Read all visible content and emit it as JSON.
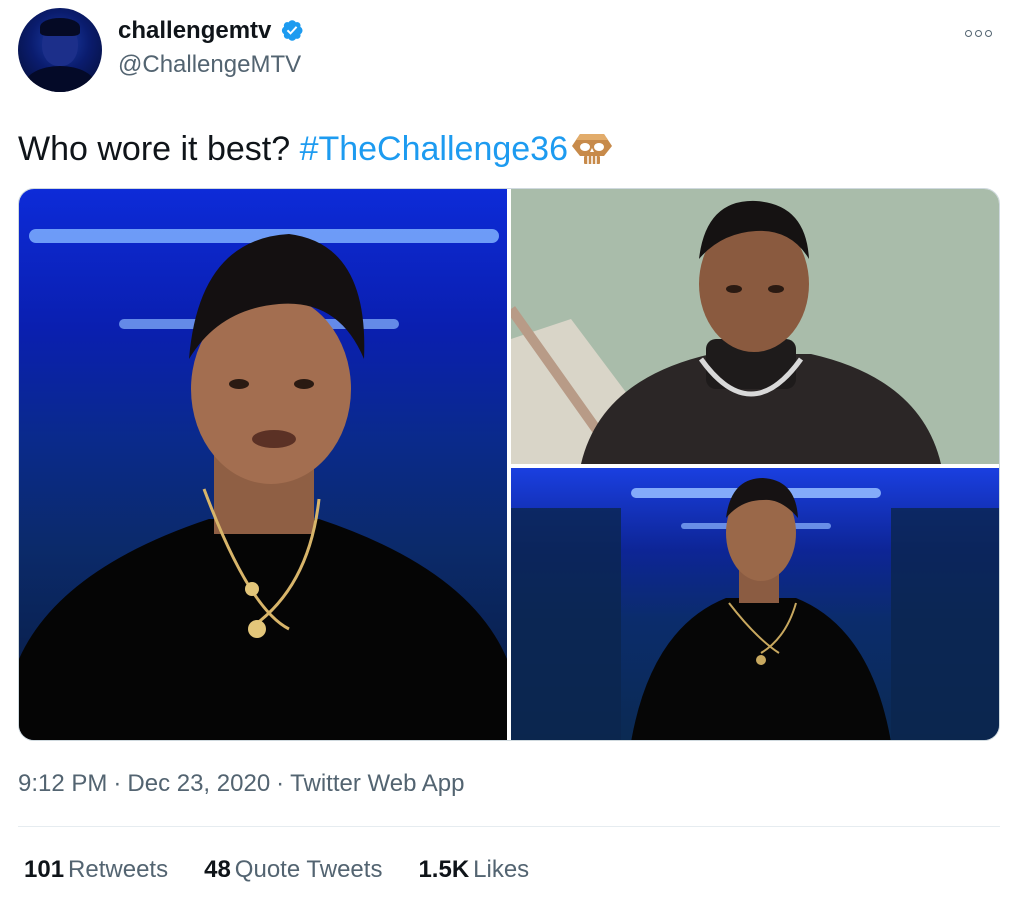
{
  "author": {
    "display_name": "challengemtv",
    "handle": "@ChallengeMTV",
    "verified": true,
    "verified_color": "#1d9bf0"
  },
  "tweet": {
    "text": "Who wore it best? ",
    "hashtag": "#TheChallenge36",
    "hashtag_emoji": "skull-hashflag-icon"
  },
  "media": [
    {
      "description": "man-in-black-turtleneck-blue-room"
    },
    {
      "description": "man-in-black-turtleneck-green-wall"
    },
    {
      "description": "man-in-black-turtleneck-blue-hallway"
    }
  ],
  "meta": {
    "time": "9:12 PM",
    "separator": "·",
    "date": "Dec 23, 2020",
    "source": "Twitter Web App"
  },
  "stats": {
    "retweets_count": "101",
    "retweets_label": "Retweets",
    "quotes_count": "48",
    "quotes_label": "Quote Tweets",
    "likes_count": "1.5K",
    "likes_label": "Likes"
  },
  "colors": {
    "link": "#1d9bf0",
    "secondary_text": "#536471",
    "primary_text": "#0f1419"
  }
}
